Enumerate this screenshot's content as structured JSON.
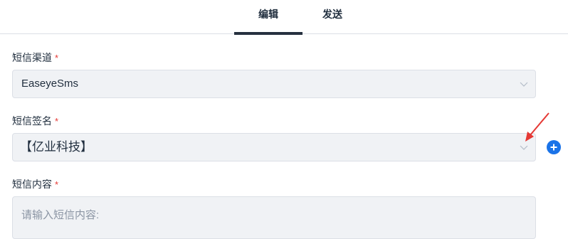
{
  "tabs": [
    {
      "label": "编辑",
      "active": true
    },
    {
      "label": "发送",
      "active": false
    }
  ],
  "form": {
    "channel": {
      "label": "短信渠道",
      "required_mark": "*",
      "value": "EaseyeSms"
    },
    "signature": {
      "label": "短信签名",
      "required_mark": "*",
      "value": "【亿业科技】"
    },
    "content": {
      "label": "短信内容",
      "required_mark": "*",
      "placeholder": "请输入短信内容:"
    }
  },
  "icons": {
    "dropdown": "chevron-down-icon",
    "add": "plus-circle-icon",
    "annotation": "red-arrow-icon"
  },
  "colors": {
    "accent": "#1a73e8",
    "required": "#e53935",
    "annotation": "#e53935",
    "tab_underline": "#26313f"
  }
}
